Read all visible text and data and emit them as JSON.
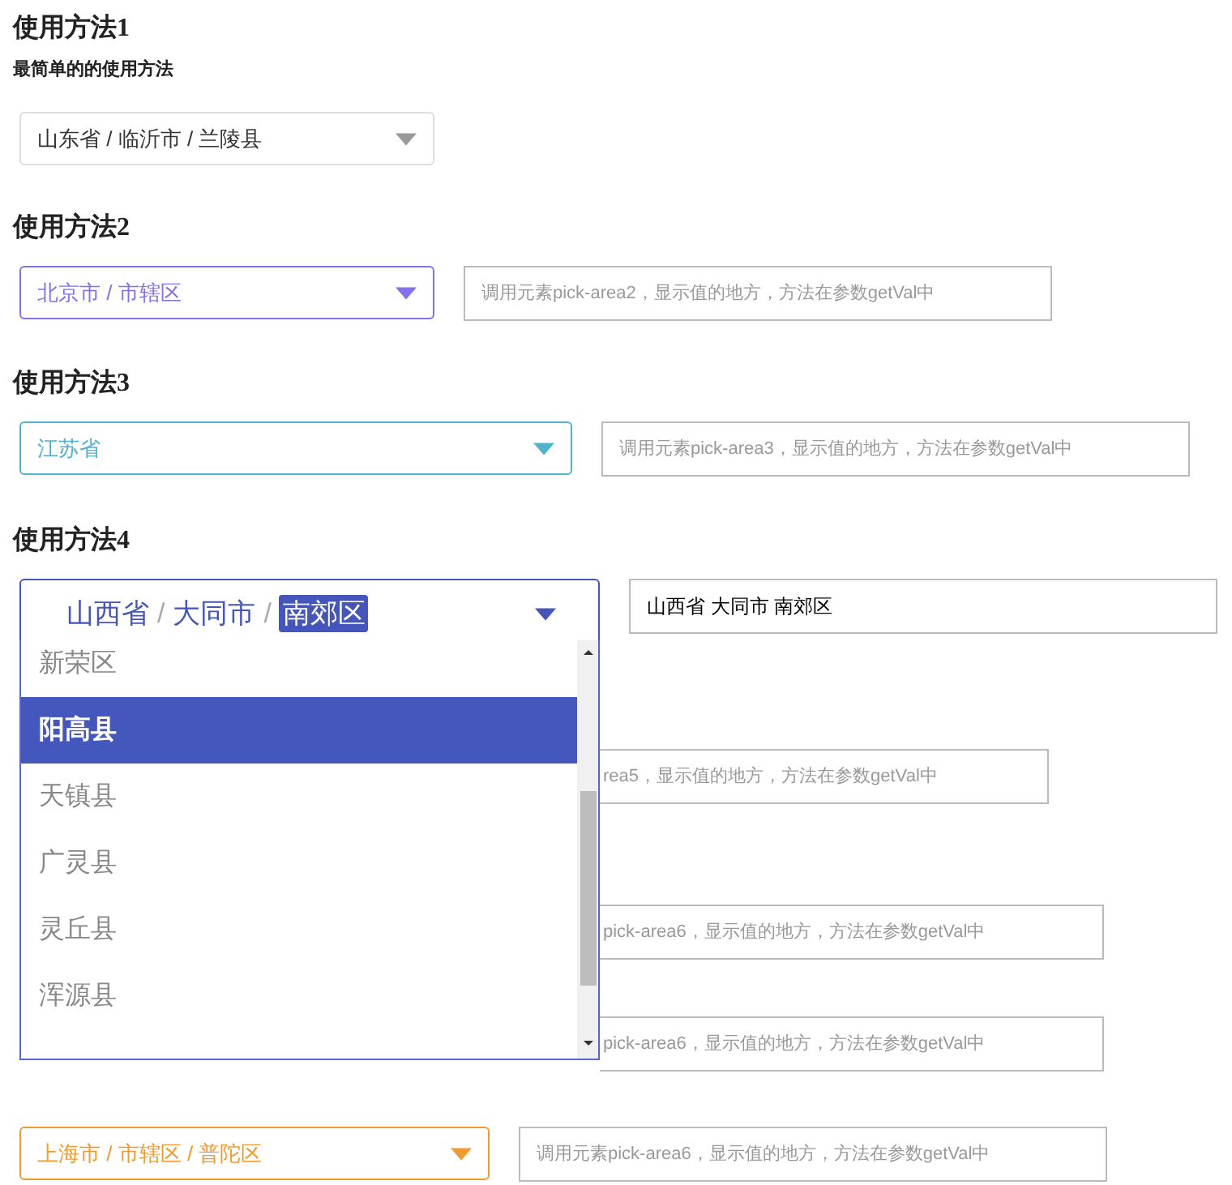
{
  "blocks": [
    {
      "kind": "heading",
      "text": "使用方法1"
    },
    {
      "kind": "note",
      "text": "最简单的的使用方法"
    },
    {
      "kind": "row",
      "picker": {
        "kind": "plain",
        "value": "山东省 / 临沂市 / 兰陵县"
      }
    },
    {
      "kind": "heading",
      "text": "使用方法2"
    },
    {
      "kind": "row",
      "picker": {
        "kind": "colored",
        "value": "北京市 / 市辖区",
        "color": "#8470ee"
      },
      "field": {
        "placeholder": "调用元素pick-area2，显示值的地方，方法在参数getVal中"
      }
    },
    {
      "kind": "heading",
      "text": "使用方法3"
    },
    {
      "kind": "row",
      "picker": {
        "kind": "colored",
        "value": "江苏省",
        "color": "#4fb3cf"
      },
      "field": {
        "placeholder": "调用元素pick-area3，显示值的地方，方法在参数getVal中"
      }
    },
    {
      "kind": "heading",
      "text": "使用方法4"
    },
    {
      "kind": "open_row",
      "picker": {
        "parts": [
          {
            "text": "山西省",
            "selected": false
          },
          {
            "text": "大同市",
            "selected": false
          },
          {
            "text": "南郊区",
            "selected": true
          }
        ],
        "separator": "/",
        "kind": "colored",
        "color": "#4455bb"
      },
      "field": {
        "value": "山西省 大同市 南郊区"
      }
    },
    {
      "kind": "covered_row",
      "field": {
        "placeholder": "rea5，显示值的地方，方法在参数getVal中"
      }
    },
    {
      "kind": "covered_row",
      "field": {
        "placeholder": "pick-area6，显示值的地方，方法在参数getVal中"
      }
    },
    {
      "kind": "covered_row",
      "field": {
        "placeholder": "pick-area6，显示值的地方，方法在参数getVal中"
      }
    },
    {
      "kind": "row",
      "picker": {
        "kind": "colored",
        "value": "上海市 / 市辖区 / 普陀区",
        "color": "#f39a2e"
      },
      "field": {
        "placeholder": "调用元素pick-area6，显示值的地方，方法在参数getVal中"
      }
    }
  ],
  "dropdown": {
    "options": [
      {
        "text": "新荣区",
        "selected": false
      },
      {
        "text": "阳高县",
        "selected": true
      },
      {
        "text": "天镇县",
        "selected": false
      },
      {
        "text": "广灵县",
        "selected": false
      },
      {
        "text": "灵丘县",
        "selected": false
      },
      {
        "text": "浑源县",
        "selected": false
      }
    ]
  }
}
